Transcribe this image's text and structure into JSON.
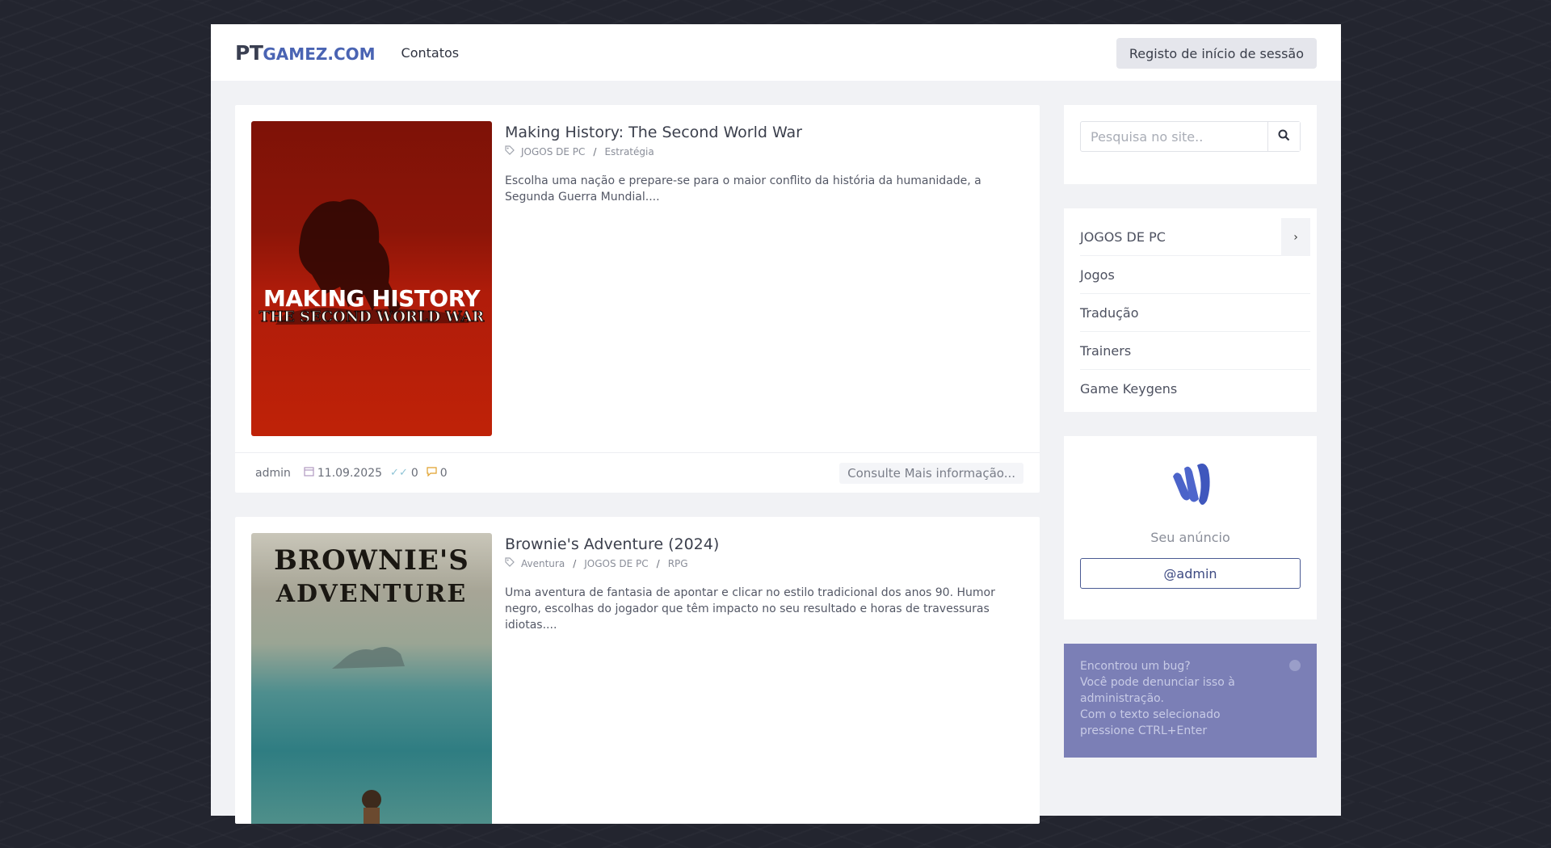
{
  "header": {
    "logo_main": "PT",
    "logo_sub": "GAMEZ.COM",
    "nav_contacts": "Contatos",
    "login_label": "Registo de início de sessão"
  },
  "posts": [
    {
      "title": "Making History: The Second World War",
      "categories": [
        "JOGOS DE PC",
        "Estratégia"
      ],
      "description": "Escolha uma nação e prepare-se para o maior conflito da história da humanidade, a Segunda Guerra Mundial....",
      "cover_text_1": "MAKING HISTORY",
      "cover_text_2": "THE SECOND WORLD WAR",
      "author": "admin",
      "date": "11.09.2025",
      "likes": "0",
      "comments": "0",
      "more_label": "Consulte Mais informação..."
    },
    {
      "title": "Brownie's Adventure (2024)",
      "categories": [
        "Aventura",
        "JOGOS DE PC",
        "RPG"
      ],
      "description": "Uma aventura de fantasia de apontar e clicar no estilo tradicional dos anos 90. Humor negro, escolhas do jogador que têm impacto no seu resultado e horas de travessuras idiotas....",
      "cover_text_1": "BROWNIE'S",
      "cover_text_2": "ADVENTURE"
    }
  ],
  "sidebar": {
    "search_placeholder": "Pesquisa no site..",
    "categories": [
      "JOGOS DE PC",
      "Jogos",
      "Tradução",
      "Trainers",
      "Game Keygens"
    ],
    "ad_label": "Seu anúncio",
    "ad_button": "@admin",
    "bug_lines": [
      "Encontrou um bug?",
      "Você pode denunciar isso à administração.",
      "Com o texto selecionado pressione CTRL+Enter"
    ]
  },
  "colors": {
    "background": "#23252f",
    "accent": "#4a64b3",
    "bug_panel": "#7b7fb6",
    "cover_red": "#b81f0c"
  }
}
